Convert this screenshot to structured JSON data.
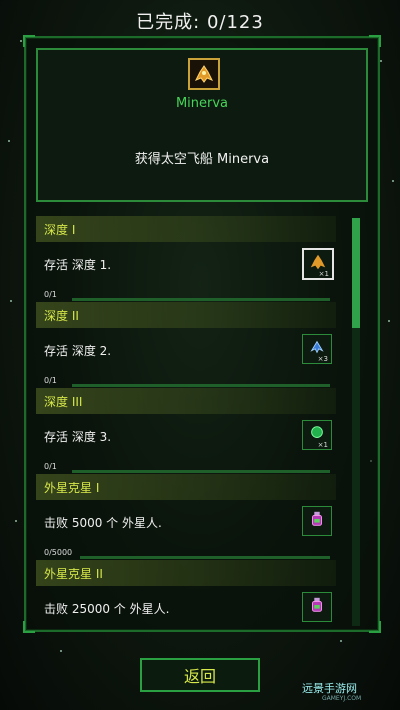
{
  "header": {
    "completed_text": "已完成: 0/123"
  },
  "featured": {
    "ship_name": "Minerva",
    "reward_text": "获得太空飞船 Minerva",
    "icon": "spaceship-icon"
  },
  "achievements": [
    {
      "title": "深度 I",
      "description": "存活 深度 1.",
      "progress": "0/1",
      "icon": "spaceship-icon",
      "multiplier": "×1"
    },
    {
      "title": "深度 II",
      "description": "存活 深度 2.",
      "progress": "0/1",
      "icon": "wing-icon",
      "multiplier": "×3"
    },
    {
      "title": "深度 III",
      "description": "存活 深度 3.",
      "progress": "0/1",
      "icon": "green-orb-icon",
      "multiplier": "×1"
    },
    {
      "title": "外星克星 I",
      "description": "击败 5000 个 外星人.",
      "progress": "0/5000",
      "icon": "potion-icon",
      "multiplier": ""
    },
    {
      "title": "外星克星 II",
      "description": "击败 25000 个 外星人.",
      "progress": "",
      "icon": "potion-icon",
      "multiplier": ""
    }
  ],
  "back_label": "返回",
  "watermark": {
    "title": "远景手游网",
    "sub": "GAMEYJ.COM"
  },
  "colors": {
    "accent": "#2aa043",
    "title_yellow": "#d7e84a",
    "ship_green": "#49d35a"
  }
}
